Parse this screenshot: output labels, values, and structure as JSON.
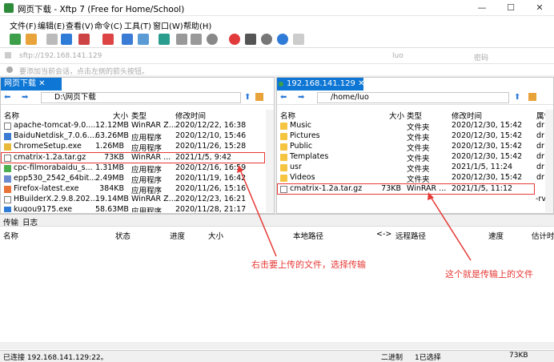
{
  "window": {
    "title": "网页下载 - Xftp 7 (Free for Home/School)"
  },
  "menu": [
    "文件(F)",
    "编辑(E)",
    "查看(V)",
    "命令(C)",
    "工具(T)",
    "窗口(W)",
    "帮助(H)"
  ],
  "address": {
    "host_placeholder": "sftp://192.168.141.129",
    "user_placeholder": "luo",
    "password_placeholder": "密码"
  },
  "hint": "要添加当前会话，点击左侧的箭头按钮。",
  "left_pane": {
    "tab_label": "网页下载",
    "path": "D:\\网页下载",
    "columns": [
      "名称",
      "大小",
      "类型",
      "修改时间"
    ],
    "files": [
      {
        "name": "apache-tomcat-9.0....",
        "size": "12.12MB",
        "type": "WinRAR Z...",
        "modified": "2020/12/22, 16:38"
      },
      {
        "name": "BaiduNetdisk_7.0.6....",
        "size": "63.26MB",
        "type": "应用程序",
        "modified": "2020/12/10, 15:46"
      },
      {
        "name": "ChromeSetup.exe",
        "size": "1.26MB",
        "type": "应用程序",
        "modified": "2020/11/26, 15:28"
      },
      {
        "name": "cmatrix-1.2a.tar.gz",
        "size": "73KB",
        "type": "WinRAR ...",
        "modified": "2021/1/5, 9:42"
      },
      {
        "name": "cpc-filmorabaidu_s...",
        "size": "1.31MB",
        "type": "应用程序",
        "modified": "2020/12/16, 16:59"
      },
      {
        "name": "epp530_2542_64bit...",
        "size": "2.49MB",
        "type": "应用程序",
        "modified": "2020/11/19, 16:42"
      },
      {
        "name": "Firefox-latest.exe",
        "size": "384KB",
        "type": "应用程序",
        "modified": "2020/11/26, 15:16"
      },
      {
        "name": "HBuilderX.2.9.8.202...",
        "size": "19.14MB",
        "type": "WinRAR Z...",
        "modified": "2020/12/23, 16:21"
      },
      {
        "name": "kugou9175.exe",
        "size": "58.63MB",
        "type": "应用程序",
        "modified": "2020/11/28, 21:17"
      }
    ]
  },
  "right_pane": {
    "tab_label": "192.168.141.129",
    "path": "/home/luo",
    "columns": [
      "名称",
      "大小",
      "类型",
      "修改时间",
      "属性"
    ],
    "files": [
      {
        "name": "Music",
        "size": "",
        "type": "文件夹",
        "modified": "2020/12/30, 15:42",
        "attr": "dr"
      },
      {
        "name": "Pictures",
        "size": "",
        "type": "文件夹",
        "modified": "2020/12/30, 15:42",
        "attr": "dr"
      },
      {
        "name": "Public",
        "size": "",
        "type": "文件夹",
        "modified": "2020/12/30, 15:42",
        "attr": "dr"
      },
      {
        "name": "Templates",
        "size": "",
        "type": "文件夹",
        "modified": "2020/12/30, 15:42",
        "attr": "dr"
      },
      {
        "name": "usr",
        "size": "",
        "type": "文件夹",
        "modified": "2021/1/5, 11:24",
        "attr": "dr"
      },
      {
        "name": "Videos",
        "size": "",
        "type": "文件夹",
        "modified": "2020/12/30, 15:42",
        "attr": "dr"
      },
      {
        "name": "cmatrix-1.2a.tar.gz",
        "size": "73KB",
        "type": "WinRAR ...",
        "modified": "2021/1/5, 11:12",
        "attr": "-rv"
      }
    ]
  },
  "bottom": {
    "tabs": [
      "传输",
      "日志"
    ],
    "columns": [
      "名称",
      "状态",
      "进度",
      "大小",
      "本地路径",
      "<->",
      "远程路径",
      "速度",
      "估计时"
    ]
  },
  "annotations": {
    "left": "右击要上传的文件，选择传输",
    "right": "这个就是传输上的文件"
  },
  "status": {
    "connection": "已连接 192.168.141.129:22。",
    "mode": "二进制",
    "selected": "1已选择",
    "size": "73KB"
  },
  "colors": {
    "accent": "#0e76d4",
    "annotation": "#e53935"
  }
}
